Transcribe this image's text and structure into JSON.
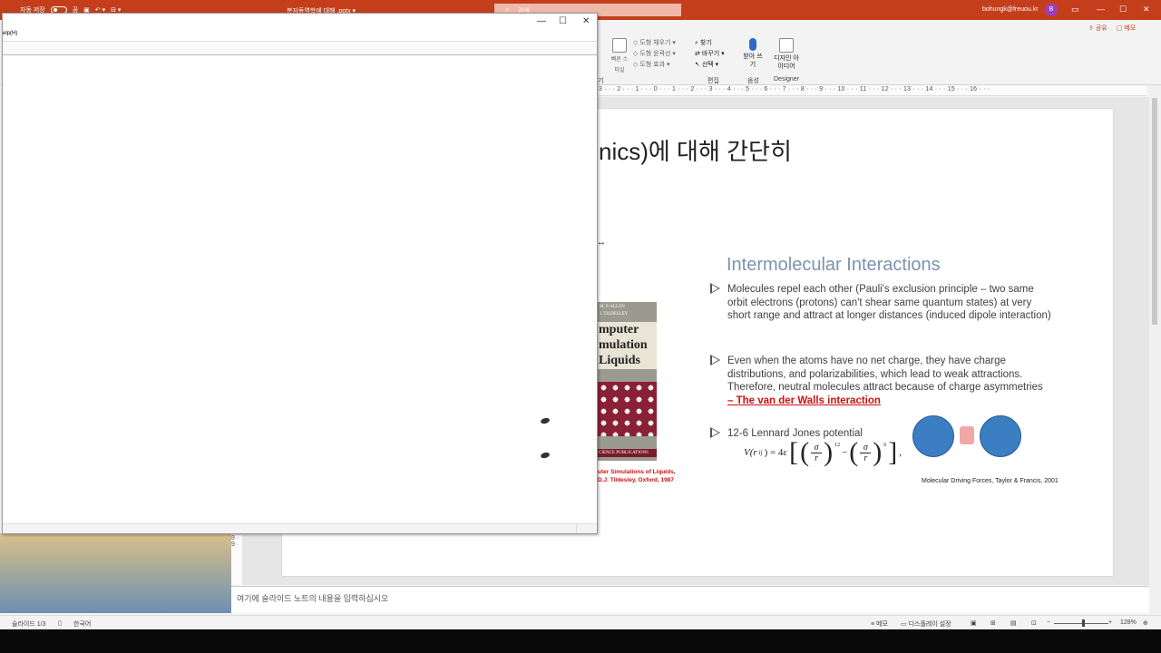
{
  "app": {
    "autosave_label": "자동 저장",
    "autosave_state": "끔",
    "doc_title": "분자동역학에 대해 .pptx ▾",
    "search_placeholder": "검색",
    "user_email": "bohungk@freuou.kr",
    "avatar_letter": "B",
    "share_label": "공유",
    "comment_label": "메모"
  },
  "ribbon": {
    "quick_styles": "빠른 스타일",
    "shape_fill": "도형 채우기",
    "shape_outline": "도형 윤곽선",
    "shape_effects": "도형 효과",
    "find": "찾기",
    "replace": "바꾸기",
    "select": "선택",
    "edit_group": "편집",
    "dictate": "받아 쓰기",
    "voice_group": "음성",
    "designer": "디자인 아이디어",
    "designer_group": "Designer",
    "drawing_group": "기"
  },
  "ruler": {
    "marks": "3 · · · 2 · · · 1 · · · 0 · · · 1 · · · 2 · · · 3 · · · 4 · · · 5 · · · 6 · · · 7 · · · 8 · · · 9 · · · 10 · · · 11 · · · 12 · · · 13 · · · 14 · · · 15 · · · 16 · · ·",
    "vmarks": "8 · 9 ·"
  },
  "slide": {
    "title": "nics)에 대해 간단히",
    "heading": "Intermolecular Interactions",
    "bullet1": "Molecules repel each other (Pauli's exclusion principle – two same orbit electrons (protons) can't shear same quantum states) at very short range and attract at longer distances (induced dipole interaction)",
    "bullet2": "Even when the atoms have no net charge, they have charge distributions, and polarizabilities, which lead to weak attractions. Therefore, neutral molecules attract because of charge asymmetries",
    "bullet2_link": "– The van der Walls interaction",
    "bullet3": "12-6 Lennard Jones potential",
    "formula": {
      "lhs": "V(r",
      "sub": "ij",
      "eq": ") = 4ε",
      "sigma": "σ",
      "r": "r",
      "exp12": "12",
      "minus": "−",
      "exp6": "6",
      "tail": ","
    },
    "credit": "Molecular Driving Forces, Taylor & Francis, 2001",
    "book": {
      "authors_line1": "M. P. ALLEN",
      "authors_line2": "J. TILDESLEY",
      "title_line1": "mputer",
      "title_line2": "mulation",
      "title_line3": "Liquids",
      "publisher": "CIENCE PUBLICATIONS",
      "caption_line1": "uter Simulations of Liquids,",
      "caption_line2": "D.J. Tildesley, Oxford, 1987"
    }
  },
  "notes": {
    "placeholder": "여기에 슬라이드 노트의 내용을 입력하십시오"
  },
  "status": {
    "slide_count": "슬라이드 1/3",
    "language": "한국어",
    "notes": "메모",
    "display_settings": "디스플레이 설정",
    "zoom": "128%"
  },
  "overlay": {
    "menu_text": "elp(H)"
  }
}
